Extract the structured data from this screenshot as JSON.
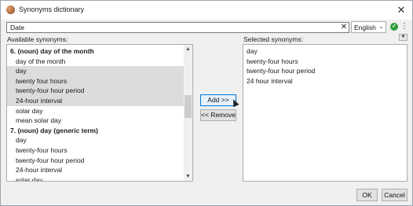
{
  "window": {
    "title": "Synonyms dictionary",
    "close_glyph": "✕"
  },
  "search": {
    "value": "Date",
    "clear_glyph": "✕"
  },
  "language": {
    "selected": "English",
    "caret_glyph": "⌄"
  },
  "toolbar": {
    "ok_glyph": "✓",
    "menu_glyph": "⋮"
  },
  "available": {
    "label": "Available synonyms:",
    "rows": [
      {
        "text": "6. (noun) day of the month",
        "kind": "header",
        "selected": false
      },
      {
        "text": "day of the month",
        "kind": "item",
        "selected": false
      },
      {
        "text": "day",
        "kind": "item",
        "selected": true
      },
      {
        "text": "twenty four hours",
        "kind": "item",
        "selected": true
      },
      {
        "text": "twenty-four hour period",
        "kind": "item",
        "selected": true
      },
      {
        "text": "24-hour interval",
        "kind": "item",
        "selected": true
      },
      {
        "text": "solar day",
        "kind": "item",
        "selected": false
      },
      {
        "text": "mean solar day",
        "kind": "item",
        "selected": false
      },
      {
        "text": "7. (noun) day (generic term)",
        "kind": "header",
        "selected": false
      },
      {
        "text": "day",
        "kind": "item",
        "selected": false
      },
      {
        "text": "twenty-four hours",
        "kind": "item",
        "selected": false
      },
      {
        "text": "twenty-four hour period",
        "kind": "item",
        "selected": false
      },
      {
        "text": "24-hour interval",
        "kind": "item",
        "selected": false
      },
      {
        "text": "solar day",
        "kind": "item",
        "selected": false
      }
    ]
  },
  "actions": {
    "add_label": "Add >>",
    "remove_label": "<< Remove"
  },
  "selected": {
    "label": "Selected synonyms:",
    "collapse_glyph": "▼",
    "rows": [
      {
        "text": "day"
      },
      {
        "text": "twenty-four hours"
      },
      {
        "text": "twenty-four hour period"
      },
      {
        "text": "24 hour interval"
      }
    ]
  },
  "footer": {
    "ok_label": "OK",
    "cancel_label": "Cancel"
  },
  "colors": {
    "selection": "#dcdcdc",
    "accent": "#0078d7",
    "ok_green": "#2e9e3e"
  }
}
